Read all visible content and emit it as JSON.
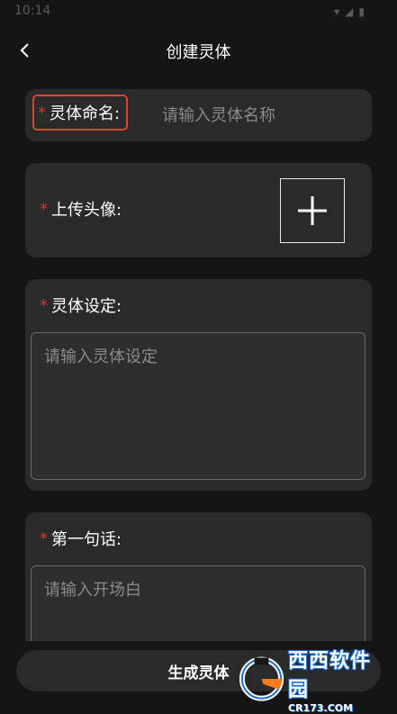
{
  "status_bar": {
    "time": "10:14",
    "icons": [
      "wifi-icon",
      "signal-icon",
      "battery-icon"
    ]
  },
  "header": {
    "title": "创建灵体",
    "back_icon": "chevron-left-icon"
  },
  "form": {
    "required_mark": "*",
    "name": {
      "label": "灵体命名:",
      "placeholder": "请输入灵体名称"
    },
    "avatar": {
      "label": "上传头像:",
      "upload_icon": "plus-icon"
    },
    "setting": {
      "label": "灵体设定:",
      "placeholder": "请输入灵体设定"
    },
    "first_sentence": {
      "label": "第一句话:",
      "placeholder": "请输入开场白"
    }
  },
  "footer": {
    "generate_label": "生成灵体"
  },
  "watermark": {
    "title": "西西软件园",
    "subtitle": "CR173.COM"
  },
  "colors": {
    "background": "#151515",
    "card": "#2a2a2a",
    "required": "#e0322d",
    "highlight_border": "#e0402e",
    "placeholder": "#8a8a8a"
  }
}
